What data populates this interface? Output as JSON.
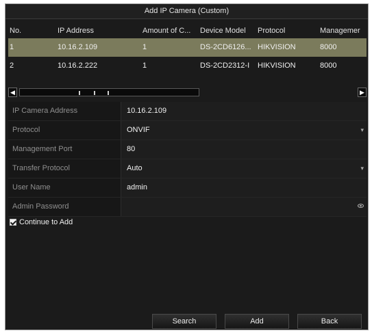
{
  "dialog": {
    "title": "Add IP Camera (Custom)"
  },
  "table": {
    "columns": [
      "No.",
      "IP Address",
      "Amount of C...",
      "Device Model",
      "Protocol",
      "Managemer"
    ],
    "rows": [
      {
        "no": "1",
        "ip": "10.16.2.109",
        "amount": "1",
        "model": "DS-2CD6126...",
        "protocol": "HIKVISION",
        "port": "8000",
        "selected": true
      },
      {
        "no": "2",
        "ip": "10.16.2.222",
        "amount": "1",
        "model": "DS-2CD2312-I",
        "protocol": "HIKVISION",
        "port": "8000",
        "selected": false
      }
    ]
  },
  "scrollbar": {
    "left_icon": "chevron-left-icon",
    "right_icon": "chevron-right-icon"
  },
  "form": {
    "ip_label": "IP Camera Address",
    "ip_value": "10.16.2.109",
    "protocol_label": "Protocol",
    "protocol_value": "ONVIF",
    "port_label": "Management Port",
    "port_value": "80",
    "transfer_label": "Transfer Protocol",
    "transfer_value": "Auto",
    "user_label": "User Name",
    "user_value": "admin",
    "password_label": "Admin Password",
    "password_value": ""
  },
  "continue_to_add": {
    "label": "Continue to Add",
    "checked": true
  },
  "buttons": {
    "search": "Search",
    "add": "Add",
    "back": "Back"
  },
  "colors": {
    "selected_row": "#7b7b5c",
    "background": "#1b1b1b"
  }
}
